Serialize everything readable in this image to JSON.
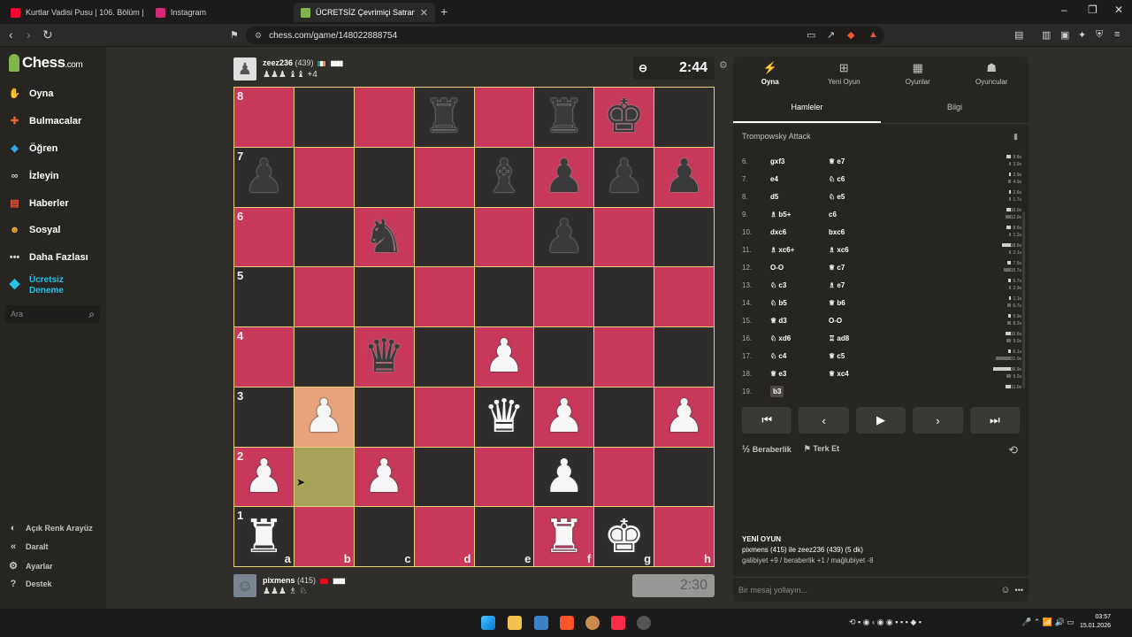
{
  "browser": {
    "tabs": [
      {
        "title": "Kurtlar Vadisi Pusu | 106. Bölüm | Yük...",
        "color": "#ff0033"
      },
      {
        "title": "Instagram",
        "color": "#d62976"
      },
      {
        "title": "ÜCRETSİZ Çevrimiçi Satranç Oyn...",
        "color": "#81b64c"
      }
    ],
    "url": "chess.com/game/148022888754"
  },
  "sidebar": {
    "logo": "Chess",
    "logo_suffix": ".com",
    "items": [
      {
        "label": "Oyna",
        "icon": "play-hand-icon",
        "color": "#e9a83b"
      },
      {
        "label": "Bulmacalar",
        "icon": "puzzle-icon",
        "color": "#e5673c"
      },
      {
        "label": "Öğren",
        "icon": "learn-icon",
        "color": "#3ba4e5"
      },
      {
        "label": "İzleyin",
        "icon": "binoculars-icon",
        "color": "#cfcfcf"
      },
      {
        "label": "Haberler",
        "icon": "news-icon",
        "color": "#e5533c"
      },
      {
        "label": "Sosyal",
        "icon": "social-icon",
        "color": "#e9a83b"
      },
      {
        "label": "Daha Fazlası",
        "icon": "more-icon",
        "color": "#cfcfcf"
      }
    ],
    "trial": {
      "label": "Ücretsiz Deneme",
      "icon": "diamond-icon",
      "color": "#26c2e5"
    },
    "search_placeholder": "Ara",
    "bottom": [
      {
        "label": "Açık Renk Arayüz",
        "icon": "theme-icon"
      },
      {
        "label": "Daralt",
        "icon": "collapse-icon"
      },
      {
        "label": "Ayarlar",
        "icon": "settings-icon"
      },
      {
        "label": "Destek",
        "icon": "help-icon"
      }
    ]
  },
  "top_player": {
    "name": "zeez236",
    "rating": "(439)",
    "captured": "♟♟♟ ♝♝ +4",
    "clock": "2:44"
  },
  "bottom_player": {
    "name": "pixmens",
    "rating": "(415)",
    "captured": "♟♟♟ ♗ ♘",
    "clock": "2:30"
  },
  "board": {
    "rows": [
      [
        "",
        "",
        "",
        "bR",
        "",
        "bR",
        "bK",
        ""
      ],
      [
        "bP",
        "",
        "",
        "",
        "bB",
        "bP",
        "bP",
        "bP"
      ],
      [
        "",
        "",
        "bN",
        "",
        "",
        "bP",
        "",
        ""
      ],
      [
        "",
        "",
        "",
        "",
        "",
        "",
        "",
        ""
      ],
      [
        "",
        "",
        "bQ",
        "",
        "wP",
        "",
        "",
        ""
      ],
      [
        "",
        "wP",
        "",
        "",
        "wQ",
        "wP",
        "",
        "wP"
      ],
      [
        "wP",
        "",
        "wP",
        "",
        "",
        "wP",
        "",
        ""
      ],
      [
        "wR",
        "",
        "",
        "",
        "",
        "wR",
        "wK",
        ""
      ]
    ],
    "ranks": [
      "8",
      "7",
      "6",
      "5",
      "4",
      "3",
      "2",
      "1"
    ],
    "files": [
      "a",
      "b",
      "c",
      "d",
      "e",
      "f",
      "g",
      "h"
    ],
    "last_move": {
      "from": "b2",
      "to": "b3"
    }
  },
  "panel": {
    "tabs": [
      {
        "label": "Oyna",
        "icon": "bolt-icon"
      },
      {
        "label": "Yeni Oyun",
        "icon": "new-game-icon"
      },
      {
        "label": "Oyunlar",
        "icon": "games-icon"
      },
      {
        "label": "Oyuncular",
        "icon": "players-icon"
      }
    ],
    "subtabs": [
      "Hamleler",
      "Bilgi"
    ],
    "opening": "Trompowsky Attack",
    "moves": [
      {
        "n": "6.",
        "w": "gxf3",
        "b": "♕ e7",
        "tw": "9.8s",
        "tb": "3.9s",
        "ww": 0.26,
        "wb": 0.1
      },
      {
        "n": "7.",
        "w": "e4",
        "b": "♘ c6",
        "tw": "2.9s",
        "tb": "4.9s",
        "ww": 0.08,
        "wb": 0.13
      },
      {
        "n": "8.",
        "w": "d5",
        "b": "♘ e5",
        "tw": "2.6s",
        "tb": "1.7s",
        "ww": 0.07,
        "wb": 0.05
      },
      {
        "n": "9.",
        "w": "♗ b5+",
        "b": "c6",
        "tw": "10.0s",
        "tb": "12.0s",
        "ww": 0.27,
        "wb": 0.32
      },
      {
        "n": "10.",
        "w": "dxc6",
        "b": "bxc6",
        "tw": "8.6s",
        "tb": "1.2s",
        "ww": 0.23,
        "wb": 0.03
      },
      {
        "n": "11.",
        "w": "♗ xc6+",
        "b": "♗ xc6",
        "tw": "18.6s",
        "tb": "2.1s",
        "ww": 0.5,
        "wb": 0.06
      },
      {
        "n": "12.",
        "w": "O-O",
        "b": "♕ c7",
        "tw": "7.5s",
        "tb": "15.7s",
        "ww": 0.2,
        "wb": 0.42
      },
      {
        "n": "13.",
        "w": "♘ c3",
        "b": "♗ e7",
        "tw": "5.7s",
        "tb": "2.3s",
        "ww": 0.15,
        "wb": 0.06
      },
      {
        "n": "14.",
        "w": "♘ b5",
        "b": "♕ b6",
        "tw": "1.1s",
        "tb": "6.7s",
        "ww": 0.03,
        "wb": 0.18
      },
      {
        "n": "15.",
        "w": "♕ d3",
        "b": "O-O",
        "tw": "5.9s",
        "tb": "8.2s",
        "ww": 0.16,
        "wb": 0.22
      },
      {
        "n": "16.",
        "w": "♘ xd6",
        "b": "♖ ad8",
        "tw": "10.6s",
        "tb": "9.0s",
        "ww": 0.28,
        "wb": 0.24
      },
      {
        "n": "17.",
        "w": "♘ c4",
        "b": "♕ c5",
        "tw": "6.1s",
        "tb": "31.0s",
        "ww": 0.16,
        "wb": 0.83
      },
      {
        "n": "18.",
        "w": "♕ e3",
        "b": "♕ xc4",
        "tw": "36.9s",
        "tb": "9.2s",
        "ww": 1.0,
        "wb": 0.25
      },
      {
        "n": "19.",
        "w": "b3",
        "b": "",
        "tw": "11.0s",
        "tb": "",
        "ww": 0.3,
        "wb": 0
      }
    ],
    "controls": [
      "⏮",
      "‹",
      "▶",
      "›",
      "⏭"
    ],
    "draw": "Beraberlik",
    "draw_prefix": "½",
    "resign": "Terk Et",
    "new_game": {
      "heading": "YENİ OYUN",
      "players": "pixmens (415) ile zeez236 (439) (5 dk)",
      "stats": "galibiyet +9 / beraberlik +1 / mağlubiyet -8"
    },
    "chat_placeholder": "Bir mesaj yollayın..."
  },
  "taskbar": {
    "time": "03:57",
    "date": "15.01.2026"
  }
}
